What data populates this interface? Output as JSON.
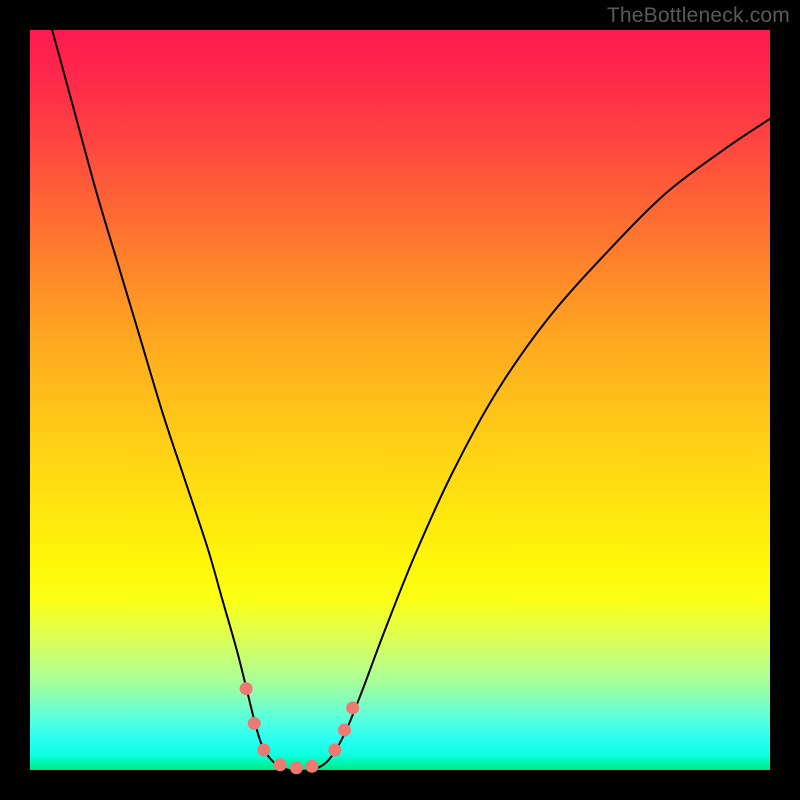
{
  "watermark": "TheBottleneck.com",
  "chart_data": {
    "type": "line",
    "title": "",
    "xlabel": "",
    "ylabel": "",
    "xlim": [
      0,
      100
    ],
    "ylim": [
      0,
      100
    ],
    "grid": false,
    "series": [
      {
        "name": "curve",
        "color": "#000000",
        "stroke_width": 2,
        "x": [
          3,
          6,
          9,
          12,
          15,
          18,
          21,
          24,
          26,
          28,
          29.5,
          30.5,
          31.5,
          33,
          35,
          38,
          40,
          41.5,
          43,
          45,
          48,
          52,
          57,
          63,
          70,
          78,
          86,
          94,
          100
        ],
        "y": [
          100,
          89,
          78,
          68,
          58,
          48,
          39,
          30,
          23,
          16,
          10,
          6,
          3,
          1,
          0,
          0,
          1,
          3,
          6,
          11,
          19,
          29,
          40,
          51,
          61,
          70,
          78,
          84,
          88
        ]
      }
    ],
    "markers": [
      {
        "x": 29.2,
        "y": 11.0,
        "r": 6.5,
        "color": "#ec7a73"
      },
      {
        "x": 30.3,
        "y": 6.3,
        "r": 6.5,
        "color": "#ec7a73"
      },
      {
        "x": 31.6,
        "y": 2.7,
        "r": 6.5,
        "color": "#ec7a73"
      },
      {
        "x": 33.8,
        "y": 0.7,
        "r": 6.5,
        "color": "#ec7a73"
      },
      {
        "x": 36.0,
        "y": 0.3,
        "r": 6.5,
        "color": "#ec7a73"
      },
      {
        "x": 38.1,
        "y": 0.5,
        "r": 6.5,
        "color": "#ec7a73"
      },
      {
        "x": 41.2,
        "y": 2.7,
        "r": 6.5,
        "color": "#ec7a73"
      },
      {
        "x": 42.5,
        "y": 5.4,
        "r": 6.5,
        "color": "#ec7a73"
      },
      {
        "x": 43.6,
        "y": 8.4,
        "r": 6.5,
        "color": "#ec7a73"
      }
    ]
  }
}
